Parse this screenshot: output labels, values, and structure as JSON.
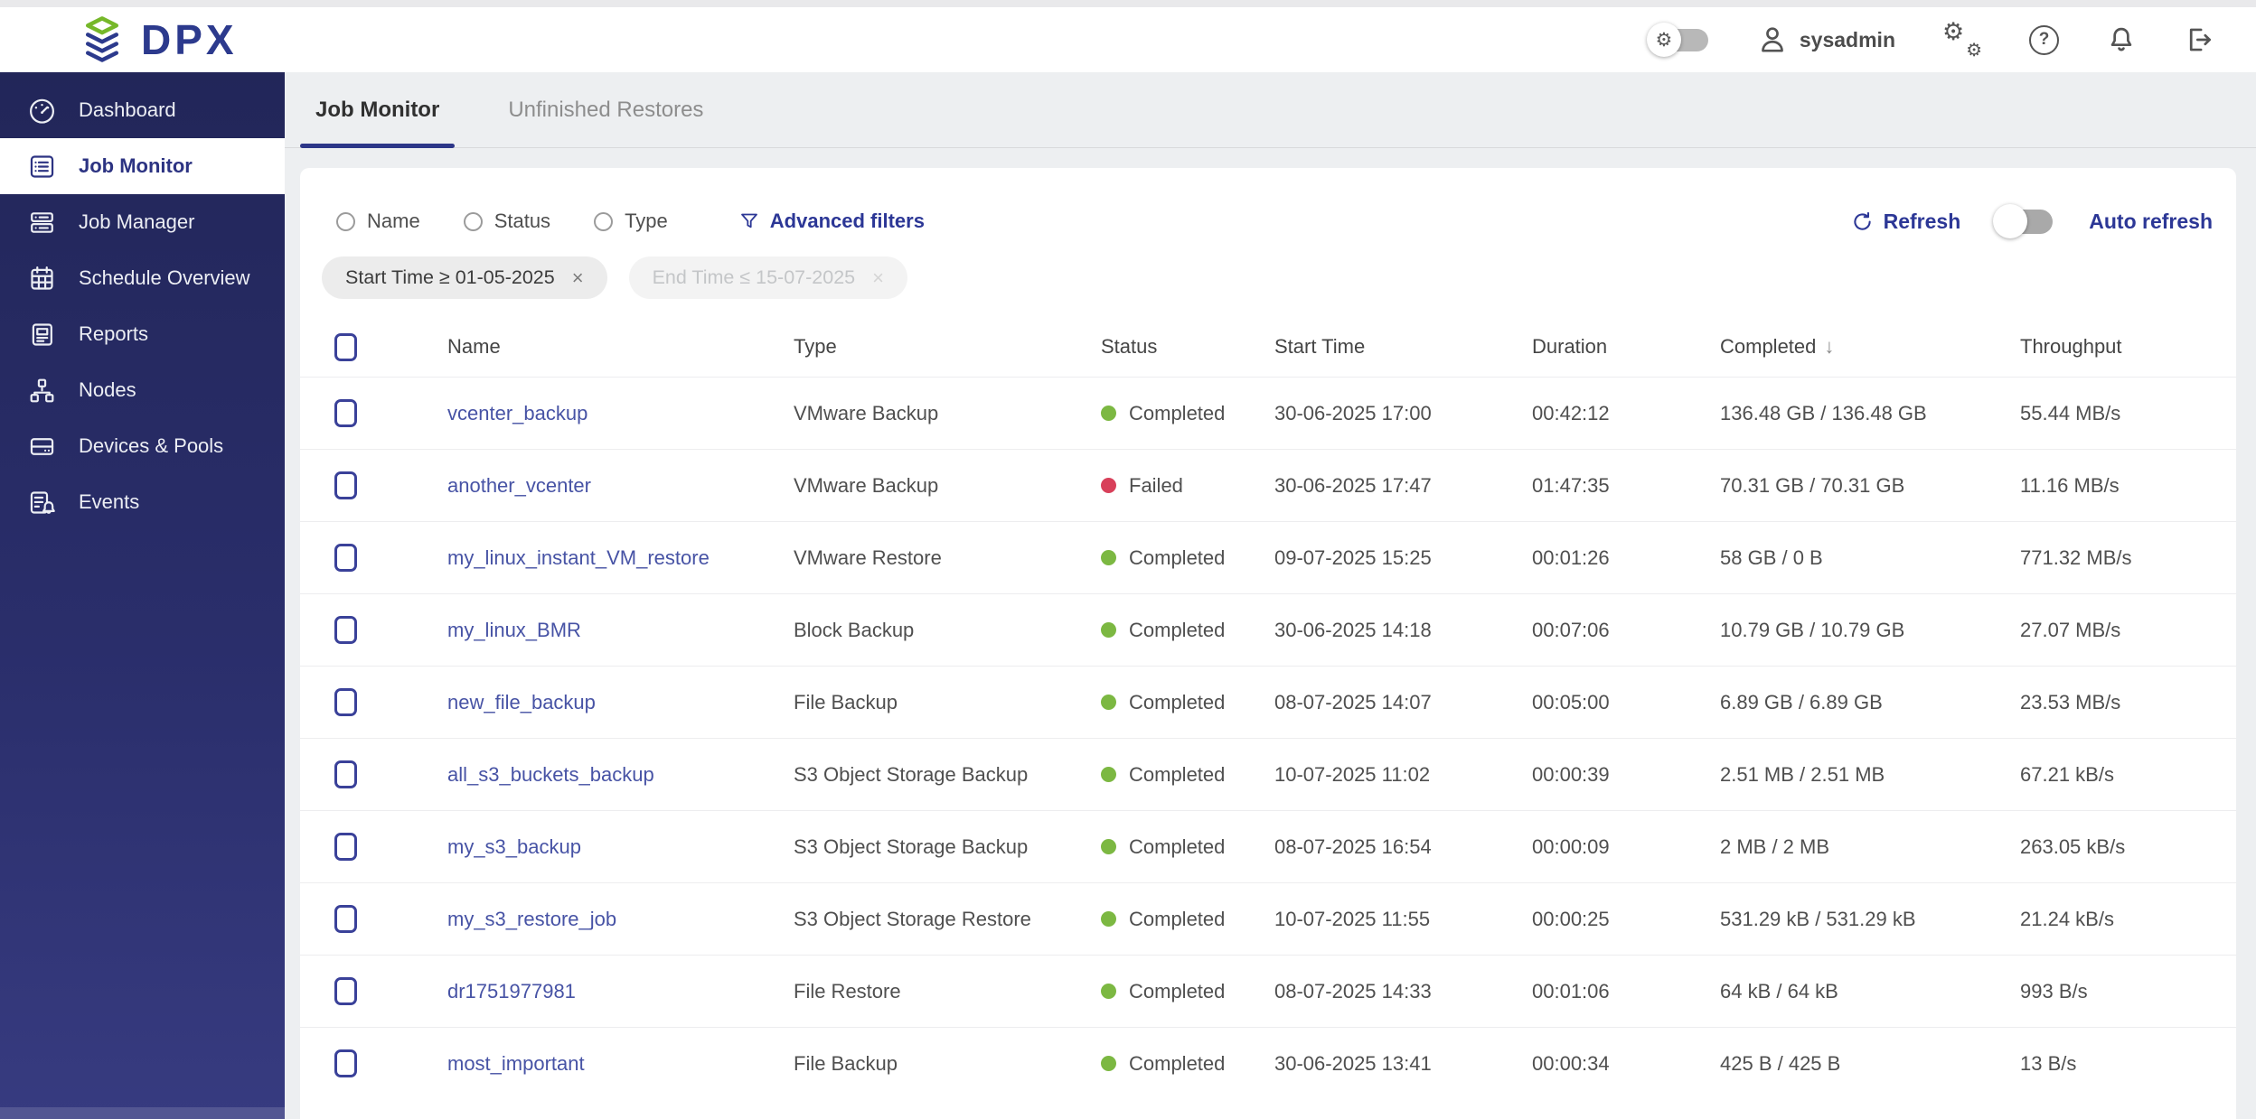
{
  "topbar": {
    "logo_text": "DPX",
    "username": "sysadmin",
    "accent_color": "#2c3a8d",
    "logo_green": "#76b82a"
  },
  "sidebar": {
    "items": [
      {
        "label": "Dashboard",
        "icon": "gauge-icon",
        "active": false
      },
      {
        "label": "Job Monitor",
        "icon": "job-monitor-list-icon",
        "active": true
      },
      {
        "label": "Job Manager",
        "icon": "job-manager-rows-icon",
        "active": false
      },
      {
        "label": "Schedule Overview",
        "icon": "calendar-icon",
        "active": false
      },
      {
        "label": "Reports",
        "icon": "report-icon",
        "active": false
      },
      {
        "label": "Nodes",
        "icon": "nodes-tree-icon",
        "active": false
      },
      {
        "label": "Devices & Pools",
        "icon": "device-icon",
        "active": false
      },
      {
        "label": "Events",
        "icon": "events-bell-icon",
        "active": false
      }
    ]
  },
  "tabs": [
    {
      "label": "Job Monitor",
      "active": true
    },
    {
      "label": "Unfinished Restores",
      "active": false
    }
  ],
  "filters": {
    "radios": [
      {
        "label": "Name",
        "checked": false
      },
      {
        "label": "Status",
        "checked": false
      },
      {
        "label": "Type",
        "checked": false
      }
    ],
    "advanced_label": "Advanced filters",
    "refresh_label": "Refresh",
    "auto_refresh_label": "Auto refresh",
    "auto_refresh_on": false,
    "chips": [
      {
        "label": "Start Time ≥ 01-05-2025",
        "dismiss": "×",
        "disabled": false
      },
      {
        "label": "End Time ≤ 15-07-2025",
        "dismiss": "×",
        "disabled": true
      }
    ]
  },
  "table": {
    "columns": [
      "Name",
      "Type",
      "Status",
      "Start Time",
      "Duration",
      "Completed",
      "Throughput"
    ],
    "sort_column": "Completed",
    "sort_direction": "desc",
    "sort_arrow": "↓",
    "status_colors": {
      "Completed": "#7cb842",
      "Failed": "#d8405a"
    },
    "rows": [
      {
        "name": "vcenter_backup",
        "type": "VMware Backup",
        "status": "Completed",
        "start_time": "30-06-2025 17:00",
        "duration": "00:42:12",
        "completed": "136.48 GB / 136.48 GB",
        "throughput": "55.44 MB/s"
      },
      {
        "name": "another_vcenter",
        "type": "VMware Backup",
        "status": "Failed",
        "start_time": "30-06-2025 17:47",
        "duration": "01:47:35",
        "completed": "70.31 GB / 70.31 GB",
        "throughput": "11.16 MB/s"
      },
      {
        "name": "my_linux_instant_VM_restore",
        "type": "VMware Restore",
        "status": "Completed",
        "start_time": "09-07-2025 15:25",
        "duration": "00:01:26",
        "completed": "58 GB / 0 B",
        "throughput": "771.32 MB/s"
      },
      {
        "name": "my_linux_BMR",
        "type": "Block Backup",
        "status": "Completed",
        "start_time": "30-06-2025 14:18",
        "duration": "00:07:06",
        "completed": "10.79 GB / 10.79 GB",
        "throughput": "27.07 MB/s"
      },
      {
        "name": "new_file_backup",
        "type": "File Backup",
        "status": "Completed",
        "start_time": "08-07-2025 14:07",
        "duration": "00:05:00",
        "completed": "6.89 GB / 6.89 GB",
        "throughput": "23.53 MB/s"
      },
      {
        "name": "all_s3_buckets_backup",
        "type": "S3 Object Storage Backup",
        "status": "Completed",
        "start_time": "10-07-2025 11:02",
        "duration": "00:00:39",
        "completed": "2.51 MB / 2.51 MB",
        "throughput": "67.21 kB/s"
      },
      {
        "name": "my_s3_backup",
        "type": "S3 Object Storage Backup",
        "status": "Completed",
        "start_time": "08-07-2025 16:54",
        "duration": "00:00:09",
        "completed": "2 MB / 2 MB",
        "throughput": "263.05 kB/s"
      },
      {
        "name": "my_s3_restore_job",
        "type": "S3 Object Storage Restore",
        "status": "Completed",
        "start_time": "10-07-2025 11:55",
        "duration": "00:00:25",
        "completed": "531.29 kB / 531.29 kB",
        "throughput": "21.24 kB/s"
      },
      {
        "name": "dr1751977981",
        "type": "File Restore",
        "status": "Completed",
        "start_time": "08-07-2025 14:33",
        "duration": "00:01:06",
        "completed": "64 kB / 64 kB",
        "throughput": "993 B/s"
      },
      {
        "name": "most_important",
        "type": "File Backup",
        "status": "Completed",
        "start_time": "30-06-2025 13:41",
        "duration": "00:00:34",
        "completed": "425 B / 425 B",
        "throughput": "13 B/s"
      }
    ]
  }
}
